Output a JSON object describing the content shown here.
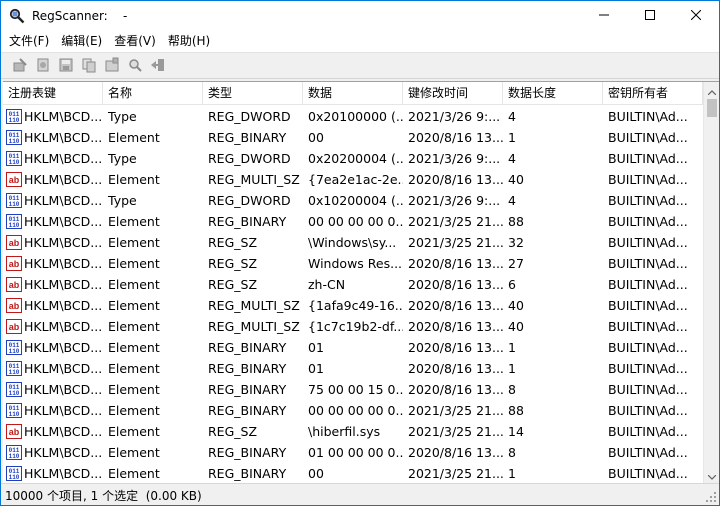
{
  "window": {
    "title": "RegScanner:    -",
    "app_icon": "regscanner-icon",
    "controls": {
      "minimize_icon": "minimize-icon",
      "maximize_icon": "maximize-icon",
      "close_icon": "close-icon"
    }
  },
  "menu": [
    "文件(F)",
    "编辑(E)",
    "查看(V)",
    "帮助(H)"
  ],
  "toolbar": {
    "buttons": [
      "new-scan-icon",
      "scan-icon",
      "save-icon",
      "copy-icon",
      "properties-icon",
      "find-icon",
      "exit-icon"
    ]
  },
  "table": {
    "columns": [
      "注册表键",
      "名称",
      "类型",
      "数据",
      "键修改时间",
      "数据长度",
      "密钥所有者"
    ],
    "rows": [
      {
        "icon": "bin",
        "key": "HKLM\\BCD...",
        "name": "Type",
        "type": "REG_DWORD",
        "data": "0x20100000 (...",
        "modified": "2021/3/26 9:...",
        "length": "4",
        "owner": "BUILTIN\\Ad..."
      },
      {
        "icon": "bin",
        "key": "HKLM\\BCD...",
        "name": "Element",
        "type": "REG_BINARY",
        "data": "00",
        "modified": "2020/8/16 13...",
        "length": "1",
        "owner": "BUILTIN\\Ad..."
      },
      {
        "icon": "bin",
        "key": "HKLM\\BCD...",
        "name": "Type",
        "type": "REG_DWORD",
        "data": "0x20200004 (...",
        "modified": "2021/3/26 9:...",
        "length": "4",
        "owner": "BUILTIN\\Ad..."
      },
      {
        "icon": "ab",
        "key": "HKLM\\BCD...",
        "name": "Element",
        "type": "REG_MULTI_SZ",
        "data": "{7ea2e1ac-2e...",
        "modified": "2020/8/16 13...",
        "length": "40",
        "owner": "BUILTIN\\Ad..."
      },
      {
        "icon": "bin",
        "key": "HKLM\\BCD...",
        "name": "Type",
        "type": "REG_DWORD",
        "data": "0x10200004 (...",
        "modified": "2021/3/26 9:...",
        "length": "4",
        "owner": "BUILTIN\\Ad..."
      },
      {
        "icon": "bin",
        "key": "HKLM\\BCD...",
        "name": "Element",
        "type": "REG_BINARY",
        "data": "00 00 00 00 0...",
        "modified": "2021/3/25 21...",
        "length": "88",
        "owner": "BUILTIN\\Ad..."
      },
      {
        "icon": "ab",
        "key": "HKLM\\BCD...",
        "name": "Element",
        "type": "REG_SZ",
        "data": "\\Windows\\sy...",
        "modified": "2021/3/25 21...",
        "length": "32",
        "owner": "BUILTIN\\Ad..."
      },
      {
        "icon": "ab",
        "key": "HKLM\\BCD...",
        "name": "Element",
        "type": "REG_SZ",
        "data": "Windows Res...",
        "modified": "2020/8/16 13...",
        "length": "27",
        "owner": "BUILTIN\\Ad..."
      },
      {
        "icon": "ab",
        "key": "HKLM\\BCD...",
        "name": "Element",
        "type": "REG_SZ",
        "data": "zh-CN",
        "modified": "2020/8/16 13...",
        "length": "6",
        "owner": "BUILTIN\\Ad..."
      },
      {
        "icon": "ab",
        "key": "HKLM\\BCD...",
        "name": "Element",
        "type": "REG_MULTI_SZ",
        "data": "{1afa9c49-16...",
        "modified": "2020/8/16 13...",
        "length": "40",
        "owner": "BUILTIN\\Ad..."
      },
      {
        "icon": "ab",
        "key": "HKLM\\BCD...",
        "name": "Element",
        "type": "REG_MULTI_SZ",
        "data": "{1c7c19b2-df...",
        "modified": "2020/8/16 13...",
        "length": "40",
        "owner": "BUILTIN\\Ad..."
      },
      {
        "icon": "bin",
        "key": "HKLM\\BCD...",
        "name": "Element",
        "type": "REG_BINARY",
        "data": "01",
        "modified": "2020/8/16 13...",
        "length": "1",
        "owner": "BUILTIN\\Ad..."
      },
      {
        "icon": "bin",
        "key": "HKLM\\BCD...",
        "name": "Element",
        "type": "REG_BINARY",
        "data": "01",
        "modified": "2020/8/16 13...",
        "length": "1",
        "owner": "BUILTIN\\Ad..."
      },
      {
        "icon": "bin",
        "key": "HKLM\\BCD...",
        "name": "Element",
        "type": "REG_BINARY",
        "data": "75 00 00 15 0...",
        "modified": "2020/8/16 13...",
        "length": "8",
        "owner": "BUILTIN\\Ad..."
      },
      {
        "icon": "bin",
        "key": "HKLM\\BCD...",
        "name": "Element",
        "type": "REG_BINARY",
        "data": "00 00 00 00 0...",
        "modified": "2021/3/25 21...",
        "length": "88",
        "owner": "BUILTIN\\Ad..."
      },
      {
        "icon": "ab",
        "key": "HKLM\\BCD...",
        "name": "Element",
        "type": "REG_SZ",
        "data": "\\hiberfil.sys",
        "modified": "2021/3/25 21...",
        "length": "14",
        "owner": "BUILTIN\\Ad..."
      },
      {
        "icon": "bin",
        "key": "HKLM\\BCD...",
        "name": "Element",
        "type": "REG_BINARY",
        "data": "01 00 00 00 0...",
        "modified": "2020/8/16 13...",
        "length": "8",
        "owner": "BUILTIN\\Ad..."
      },
      {
        "icon": "bin",
        "key": "HKLM\\BCD...",
        "name": "Element",
        "type": "REG_BINARY",
        "data": "00",
        "modified": "2021/3/25 21...",
        "length": "1",
        "owner": "BUILTIN\\Ad..."
      }
    ]
  },
  "status": {
    "text": "10000 个项目, 1 个选定  (0.00 KB)"
  },
  "colors": {
    "accent": "#0078d7",
    "binary_icon": "#1f3fbf",
    "string_icon": "#c01818"
  }
}
